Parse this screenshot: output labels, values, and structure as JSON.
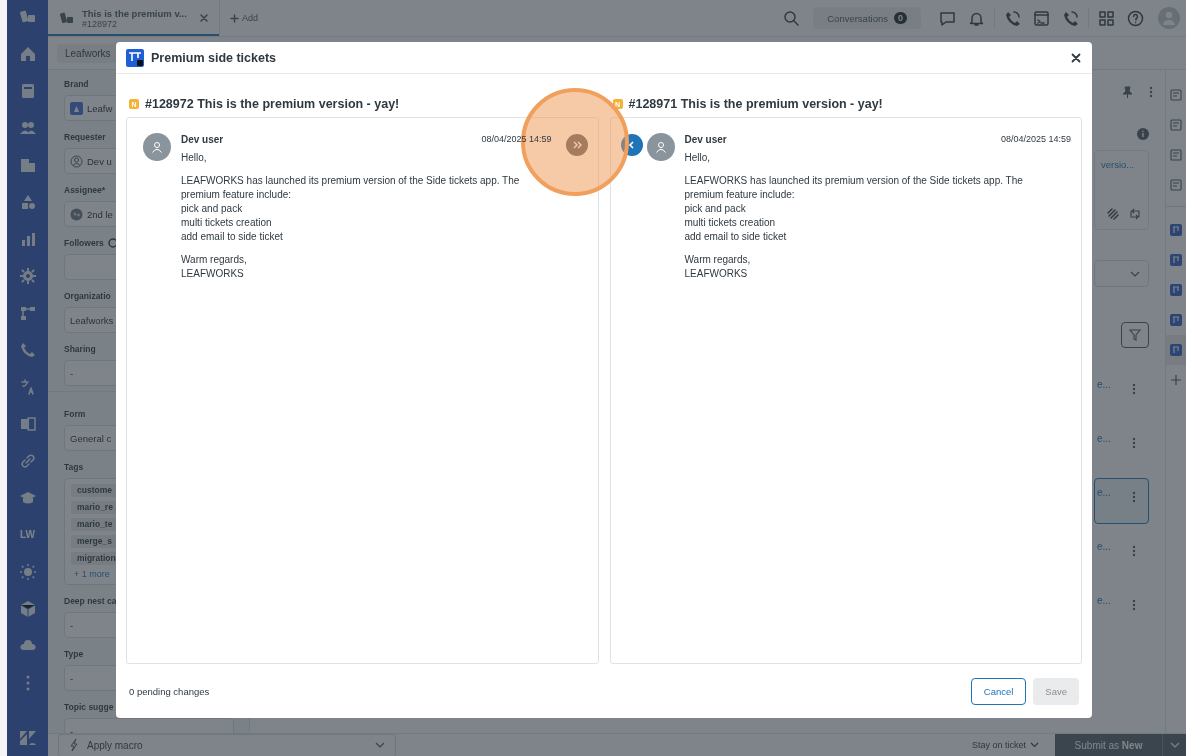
{
  "top_bar": {
    "tabs": [
      {
        "title": "This is the premium v...",
        "subtitle": "#128972",
        "selected": true
      }
    ],
    "add_label": "Add",
    "conversations": {
      "label": "Conversations",
      "count": "0"
    }
  },
  "nav": {
    "text_item": "LW"
  },
  "breadcrumb": "Leafworks",
  "properties": [
    {
      "kind": "brand",
      "label": "Brand",
      "value": "Leafw"
    },
    {
      "kind": "requester",
      "label": "Requester",
      "value": "Dev u"
    },
    {
      "kind": "assignee",
      "label": "Assignee*",
      "value": "2nd le"
    },
    {
      "kind": "followers",
      "label": "Followers"
    },
    {
      "kind": "text",
      "label": "Organizatio",
      "value": "Leafworks"
    },
    {
      "kind": "text",
      "label": "Sharing",
      "value": "-"
    },
    {
      "kind": "divider"
    },
    {
      "kind": "text",
      "label": "Form",
      "value": "General c"
    },
    {
      "kind": "tags",
      "label": "Tags",
      "tags": [
        "custome",
        "mario_re",
        "mario_te",
        "merge_s",
        "migration"
      ],
      "more": "+ 1 more"
    },
    {
      "kind": "text",
      "label": "Deep nest ca",
      "value": "-"
    },
    {
      "kind": "text",
      "label": "Type",
      "value": "-"
    },
    {
      "kind": "text",
      "label": "Topic sugge",
      "value": "-"
    }
  ],
  "side_panel": {
    "link": "versio...",
    "items": [
      {
        "text": "e...",
        "selected": false
      },
      {
        "text": "e...",
        "selected": false
      },
      {
        "text": "e...",
        "selected": true
      },
      {
        "text": "e...",
        "selected": false
      },
      {
        "text": "e...",
        "selected": false
      }
    ]
  },
  "modal": {
    "title": "Premium side tickets",
    "panes": [
      {
        "badge": "N",
        "title": "#128972 This is the premium version - yay!",
        "author": "Dev user",
        "time": "08/04/2025 14:59",
        "kind": "source",
        "paragraphs": [
          "Hello,",
          "LEAFWORKS has launched its premium version of the Side tickets app. The premium feature include:\npick and pack\nmulti tickets creation\nadd email to side ticket",
          "Warm regards,\nLEAFWORKS"
        ]
      },
      {
        "badge": "N",
        "title": "#128971 This is the premium version - yay!",
        "author": "Dev user",
        "time": "08/04/2025 14:59",
        "kind": "target",
        "paragraphs": [
          "Hello,",
          "LEAFWORKS has launched its premium version of the Side tickets app. The premium feature include:\npick and pack\nmulti tickets creation\nadd email to side ticket",
          "Warm regards,\nLEAFWORKS"
        ]
      }
    ],
    "pending": "0 pending changes",
    "cancel": "Cancel",
    "save": {
      "label": "Save",
      "disabled": true
    }
  },
  "bottom_bar": {
    "macro": "Apply macro",
    "stay": "Stay on ticket",
    "submit": "Submit as **New**"
  }
}
